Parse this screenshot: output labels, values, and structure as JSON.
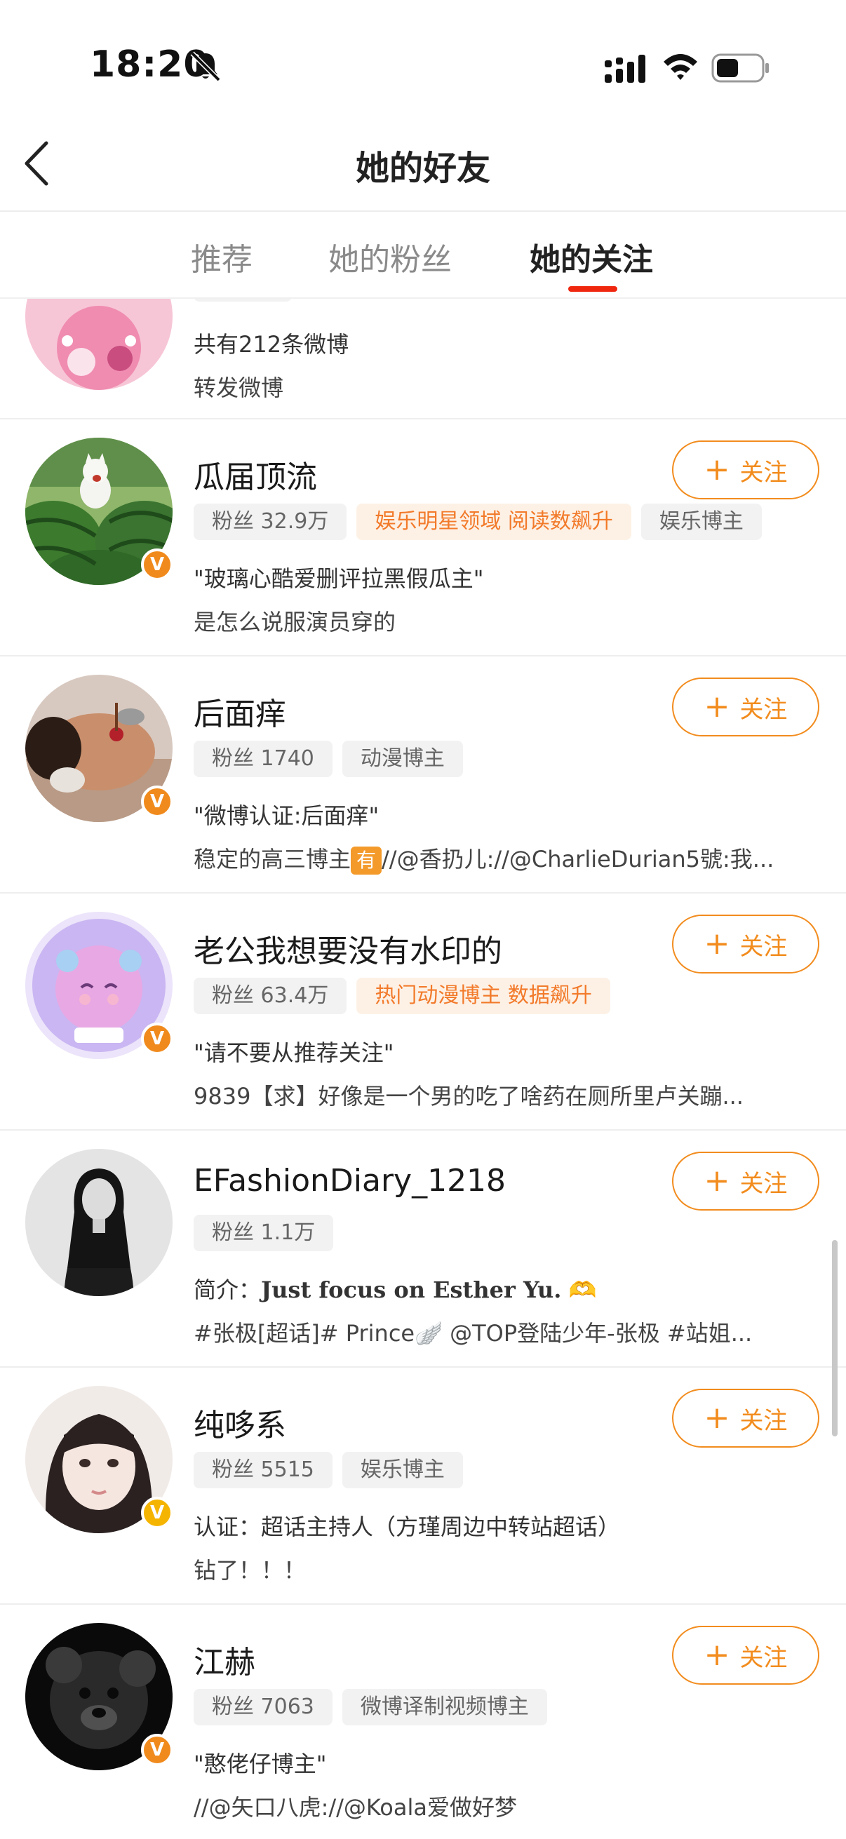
{
  "status_bar": {
    "time": "18:20",
    "icons": [
      "bell-off-icon",
      "signal-icon",
      "wifi-icon",
      "battery-icon"
    ]
  },
  "header": {
    "back_icon": "chevron-left-icon",
    "title": "她的好友"
  },
  "tabs": [
    {
      "label": "推荐",
      "active": false
    },
    {
      "label": "她的粉丝",
      "active": false
    },
    {
      "label": "她的关注",
      "active": true
    }
  ],
  "colors": {
    "accent": "#f28c1e",
    "tab_underline": "#f0270f",
    "verified_orange": "#f08a1c",
    "verified_gold": "#f5b400"
  },
  "partial_item": {
    "desc1": "共有212条微博",
    "desc2": "转发微博"
  },
  "follow_label": "关注",
  "users": [
    {
      "name": "瓜届顶流",
      "verified": "orange",
      "tags": [
        {
          "text": "粉丝 32.9万",
          "hot": false
        },
        {
          "text": "娱乐明星领域 阅读数飙升",
          "hot": true
        },
        {
          "text": "娱乐博主",
          "hot": false
        }
      ],
      "desc1": "\"玻璃心酷爱删评拉黑假瓜主\"",
      "desc2": "是怎么说服演员穿的"
    },
    {
      "name": "后面痒",
      "verified": "orange",
      "tags": [
        {
          "text": "粉丝 1740",
          "hot": false
        },
        {
          "text": "动漫博主",
          "hot": false
        }
      ],
      "desc1": "\"微博认证:后面痒\"",
      "desc2_pre": "稳定的高三博主",
      "desc2_emoji": "有",
      "desc2_post": "//@香扔儿://@CharlieDurian5號:我..."
    },
    {
      "name": "老公我想要没有水印的",
      "verified": "orange",
      "tags": [
        {
          "text": "粉丝 63.4万",
          "hot": false
        },
        {
          "text": "热门动漫博主 数据飙升",
          "hot": true
        }
      ],
      "desc1": "\"请不要从推荐关注\"",
      "desc2": "9839【求】好像是一个男的吃了啥药在厕所里卢关蹦..."
    },
    {
      "name": "EFashionDiary_1218",
      "verified": "none",
      "tags": [
        {
          "text": "粉丝 1.1万",
          "hot": false
        }
      ],
      "desc1_prefix": "简介：",
      "desc1_bold": "Just focus on Esther Yu.",
      "desc1_emoji": "🫶",
      "desc2": "#张极[超话]# Prince🪽 @TOP登陆少年-张极 #站姐..."
    },
    {
      "name": "纯哆系",
      "verified": "gold",
      "tags": [
        {
          "text": "粉丝 5515",
          "hot": false
        },
        {
          "text": "娱乐博主",
          "hot": false
        }
      ],
      "desc1": "认证：超话主持人（方瑾周边中转站超话）",
      "desc2": "钻了！！！"
    },
    {
      "name": "江赫",
      "verified": "orange",
      "tags": [
        {
          "text": "粉丝 7063",
          "hot": false
        },
        {
          "text": "微博译制视频博主",
          "hot": false
        }
      ],
      "desc1": "\"憨佬仔博主\"",
      "desc2": "//@矢口八虎://@Koala爱做好梦"
    }
  ]
}
